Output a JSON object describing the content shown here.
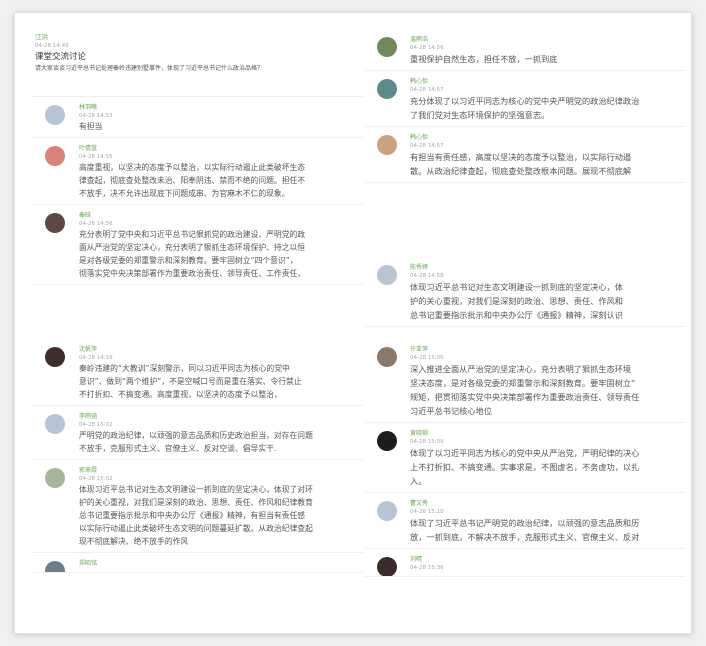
{
  "post": {
    "author": "江洪",
    "time": "04-28 14:49",
    "title": "课堂交流讨论",
    "question": "请大家谈谈习近平总书记处理秦岭违建别墅事件，体现了习近平总书记什么政治品格？"
  },
  "left_top_comments": [
    {
      "name": "林羽曦",
      "time": "04-28 14:53",
      "avatar_color": "#b7c4d6",
      "lines": [
        "有担当"
      ]
    },
    {
      "name": "叶倩蓝",
      "time": "04-28 14:55",
      "avatar_color": "#d9827a",
      "lines": [
        "高度重视，以坚决的态度予以整治，以实际行动遏止此类破坏生态",
        "律查起，彻底查处整改未治、阳奉阴违、禁而不绝的问题。担任不",
        "不放手，决不允许出现底下问题成串、为官麻木不仁的现象。"
      ]
    },
    {
      "name": "秦晗",
      "time": "04-28 14:56",
      "avatar_color": "#5b4a42",
      "lines": [
        "充分表明了党中央和习近平总书记狠抓党的政治建设、严明党的政",
        "面从严治党的坚定决心，充分表明了狠抓生态环境保护、持之以恒",
        "是对各级党委的郑重警示和深刻教育。要牢固树立“四个意识”，",
        "彻落实党中央决策部署作为重要政治责任、领导责任、工作责任，"
      ]
    }
  ],
  "left_bottom_comments": [
    {
      "name": "沈帆萍",
      "time": "04-28 14:59",
      "avatar_color": "#3d2e2b",
      "lines": [
        "秦岭违建的“大教训”深刻警示，同以习近平同志为核心的党中",
        "意识”、做到“两个维护”，不是空喊口号而是重在落实、令行禁止",
        "不打折扣、不搞变通。高度重视，以坚决的态度予以整治，"
      ]
    },
    {
      "name": "李雨涵",
      "time": "04-28 15:02",
      "avatar_color": "#b7c4d6",
      "lines": [
        "严明党的政治纪律，以顽强的意志品质和历史政治担当，对存在问题",
        "不放手，克服形式主义、官僚主义、反对空谈、倡导实干."
      ]
    },
    {
      "name": "郭來霞",
      "time": "04-28 15:02",
      "avatar_color": "#a7b59a",
      "lines": [
        "体现习近平总书记对生态文明建设一抓到底的坚定决心，体现了对环",
        "护的关心重视，对我们是深刻的政治、思想、责任、作风和纪律教育",
        "总书记重要指示批示和中央办公厅《通报》精神，有担当有责任感",
        "以实际行动遏止此类破坏生态文明的问题蔓延扩散。从政治纪律查起",
        "现不彻底解决、绝不放手的作风"
      ]
    },
    {
      "name": "郑昭铭",
      "time": "",
      "avatar_color": "#6e7d8a",
      "lines": []
    }
  ],
  "right_top_comments": [
    {
      "name": "温雨浩",
      "time": "04-28 14:56",
      "avatar_color": "#6f8a5b",
      "lines": [
        "重视保护自然生态，担任不放，一抓到底"
      ]
    },
    {
      "name": "韩心怡",
      "time": "04-28 14:57",
      "avatar_color": "#5d8a8a",
      "lines": [
        "充分体现了以习近平同志为核心的党中央严明党的政治纪律政治",
        "了我们党对生态环境保护的坚强意志。"
      ]
    },
    {
      "name": "韩心怡",
      "time": "04-28 14:57",
      "avatar_color": "#c9a37f",
      "lines": [
        "有担当有责任感，高度以坚决的态度予以整治，以实际行动遏",
        "散。从政治纪律查起，彻底查处整改根本问题。展现不彻底解"
      ]
    }
  ],
  "right_mid_comments": [
    {
      "name": "陈秀婷",
      "time": "04-28 14:58",
      "avatar_color": "#b7c4d6",
      "lines": [
        "体现习近平总书记对生态文明建设一抓到底的坚定决心，体",
        "护的关心重视，对我们是深刻的政治、思想、责任、作风和",
        "总书记重要指示批示和中央办公厅《通报》精神，深刻认识"
      ]
    }
  ],
  "right_bottom_comments": [
    {
      "name": "许亚萍",
      "time": "04-28 15:06",
      "avatar_color": "#8b7a6a",
      "lines": [
        "深入推进全面从严治党的坚定决心，充分表明了狠抓生态环境",
        "坚决态度，是对各级党委的郑重警示和深刻教育。要牢固树立“",
        "规矩，把贯彻落实党中央决策部署作为重要政治责任、领导责任",
        "习近平总书记核心地位"
      ]
    },
    {
      "name": "黄晓娴",
      "time": "04-28 15:09",
      "avatar_color": "#1d1d1d",
      "lines": [
        "体现了以习近平同志为核心的党中央从严治党，严明纪律的决心",
        "上不打折扣、不搞变通。实事求是，不图虚名，不务虚功，以扎",
        "入。"
      ]
    },
    {
      "name": "曹文秀",
      "time": "04-28 15:10",
      "avatar_color": "#b7c4d6",
      "lines": [
        "体现了习近平总书记严明党的政治纪律，以顽强的意志品质和历",
        "放，一抓到底，不解决不放手，克服形式主义、官僚主义、反对"
      ]
    },
    {
      "name": "刘晴",
      "time": "04-28 15:36",
      "avatar_color": "#3a2a2a",
      "lines": []
    }
  ]
}
